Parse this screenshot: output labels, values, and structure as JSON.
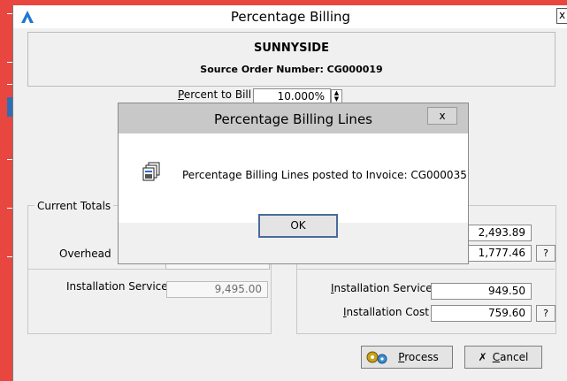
{
  "window": {
    "title": "Percentage Billing",
    "close_glyph": "x",
    "logo_icon": "app-logo-icon"
  },
  "header": {
    "customer": "SUNNYSIDE",
    "source_order_label": "Source Order Number: CG000019"
  },
  "percent": {
    "label_prefix": "",
    "label_underlined": "P",
    "label_rest": "ercent to Bill",
    "value": "10.000%"
  },
  "current_totals": {
    "title": "Current Totals",
    "overhead_label": "Overhead",
    "installation_service_label": "Installation Service",
    "installation_service_value": "9,495.00"
  },
  "billing_totals": {
    "top_value": "2,493.89",
    "second_value": "1,777.46",
    "installation_service_label_u": "I",
    "installation_service_label_rest": "nstallation Service",
    "installation_service_value": "949.50",
    "installation_cost_label_u": "I",
    "installation_cost_label_rest": "nstallation Cost",
    "installation_cost_value": "759.60",
    "lookup_label": "?"
  },
  "buttons": {
    "process_u": "P",
    "process_rest": "rocess",
    "cancel_u": "C",
    "cancel_rest": "ancel"
  },
  "dialog": {
    "title": "Percentage Billing Lines",
    "close_glyph": "x",
    "message": "Percentage Billing Lines posted to  Invoice: CG000035",
    "ok_label": "OK"
  },
  "colors": {
    "background": "#e8473f",
    "window": "#f0f0f0",
    "accent": "#2d6fb5"
  }
}
